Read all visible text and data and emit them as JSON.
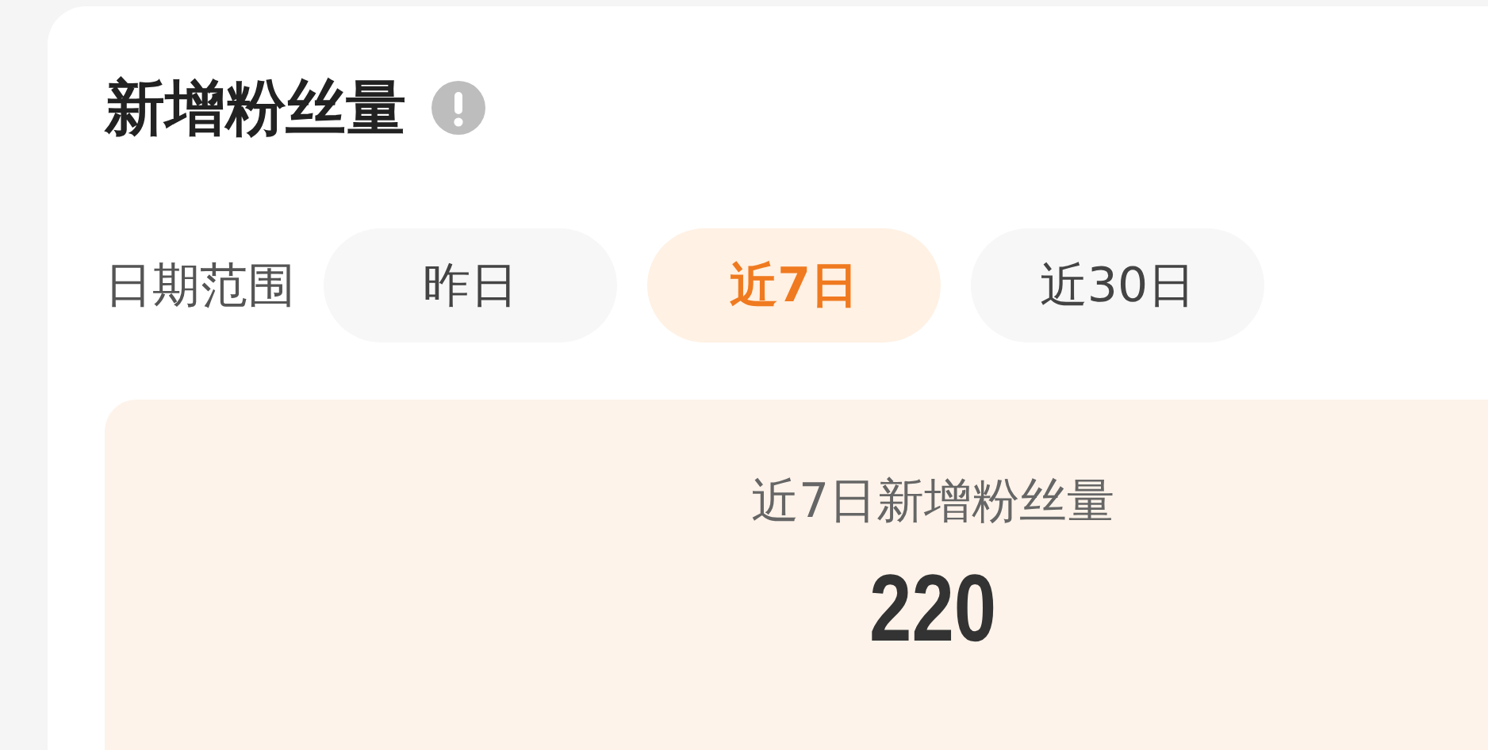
{
  "card": {
    "title": "新增粉丝量"
  },
  "date_range": {
    "label": "日期范围",
    "options": [
      {
        "label": "昨日",
        "selected": false
      },
      {
        "label": "近7日",
        "selected": true
      },
      {
        "label": "近30日",
        "selected": false
      }
    ]
  },
  "summary": {
    "label": "近7日新增粉丝量",
    "value": "220"
  }
}
